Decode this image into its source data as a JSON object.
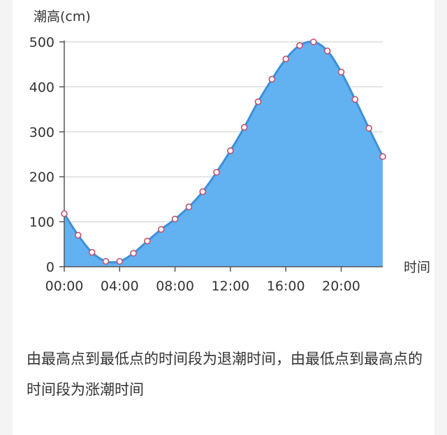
{
  "chart_data": {
    "type": "area",
    "ylabel": "潮高(cm)",
    "xlabel": "时间",
    "ylim": [
      0,
      500
    ],
    "yticks": [
      "0",
      "100",
      "200",
      "300",
      "400",
      "500"
    ],
    "xlim": [
      0,
      23
    ],
    "xticks": [
      {
        "x": 0,
        "label": "00:00"
      },
      {
        "x": 4,
        "label": "04:00"
      },
      {
        "x": 8,
        "label": "08:00"
      },
      {
        "x": 12,
        "label": "12:00"
      },
      {
        "x": 16,
        "label": "16:00"
      },
      {
        "x": 20,
        "label": "20:00"
      }
    ],
    "grid": true,
    "x": [
      0,
      1,
      2,
      3,
      4,
      5,
      6,
      7,
      8,
      9,
      10,
      11,
      12,
      13,
      14,
      15,
      16,
      17,
      18,
      19,
      20,
      21,
      22,
      23
    ],
    "values": [
      118,
      70,
      32,
      12,
      12,
      30,
      57,
      83,
      106,
      133,
      167,
      210,
      258,
      310,
      367,
      417,
      462,
      492,
      500,
      480,
      433,
      372,
      308,
      245
    ],
    "colors": {
      "fill": "#62b2f2",
      "line": "#3d8fda",
      "marker_edge": "#c0506b",
      "grid": "#d4d4d4",
      "axis": "#555555"
    }
  },
  "caption": "由最高点到最低点的时间段为退潮时间，由最低点到最高点的时间段为涨潮时间"
}
